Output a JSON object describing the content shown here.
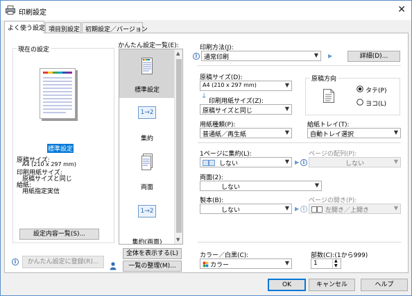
{
  "title": "印刷設定",
  "tabs": [
    "よく使う設定",
    "項目別設定",
    "初期設定／バージョン"
  ],
  "current": {
    "group_label": "現在の設定",
    "name": "標準設定",
    "details": [
      "原稿サイズ:",
      "A4 (210 x 297 mm)",
      "印刷用紙サイズ:",
      "原稿サイズと同じ",
      "給紙:",
      "用紙指定実信"
    ],
    "list_button": "設定内容一覧(S)...",
    "register_button": "かんたん設定に登録(R)..."
  },
  "quick": {
    "label": "かんたん設定一覧(E):",
    "items": [
      "標準設定",
      "集約",
      "両面",
      "集約(両面)"
    ],
    "icon_text": "1→2",
    "show_all_button": "全体を表示する(L)",
    "organize_button": "一覧の整理(M)..."
  },
  "print_method": {
    "label": "印刷方法(J):",
    "value": "通常印刷",
    "details_button": "詳細(D)..."
  },
  "orig_size": {
    "label": "原稿サイズ(D):",
    "value": "A4 (210 x 297 mm)"
  },
  "paper_size": {
    "label": "印刷用紙サイズ(Z):",
    "value": "原稿サイズと同じ"
  },
  "orientation": {
    "label": "原稿方向",
    "options": [
      "タテ(P)",
      "ヨコ(L)"
    ],
    "selected": 0
  },
  "paper_type": {
    "label": "用紙種類(P):",
    "value": "普通紙／再生紙"
  },
  "tray": {
    "label": "給紙トレイ(T):",
    "value": "自動トレイ選択"
  },
  "nup": {
    "label": "1ページに集約(L):",
    "value": "しない"
  },
  "page_order": {
    "label": "ページの配列(P):",
    "value": "しない"
  },
  "duplex": {
    "label": "両面(2):",
    "value": "しない"
  },
  "booklet": {
    "label": "製本(B):",
    "value": "しない"
  },
  "page_layout": {
    "label": "ページの開き(P):",
    "value": "左開き／上開き"
  },
  "color": {
    "label": "カラー／白黒(C):",
    "value": "カラー"
  },
  "copies": {
    "label": "部数(C):(1から999)",
    "value": "1"
  },
  "footer": {
    "ok": "OK",
    "cancel": "キャンセル",
    "help": "ヘルプ"
  }
}
